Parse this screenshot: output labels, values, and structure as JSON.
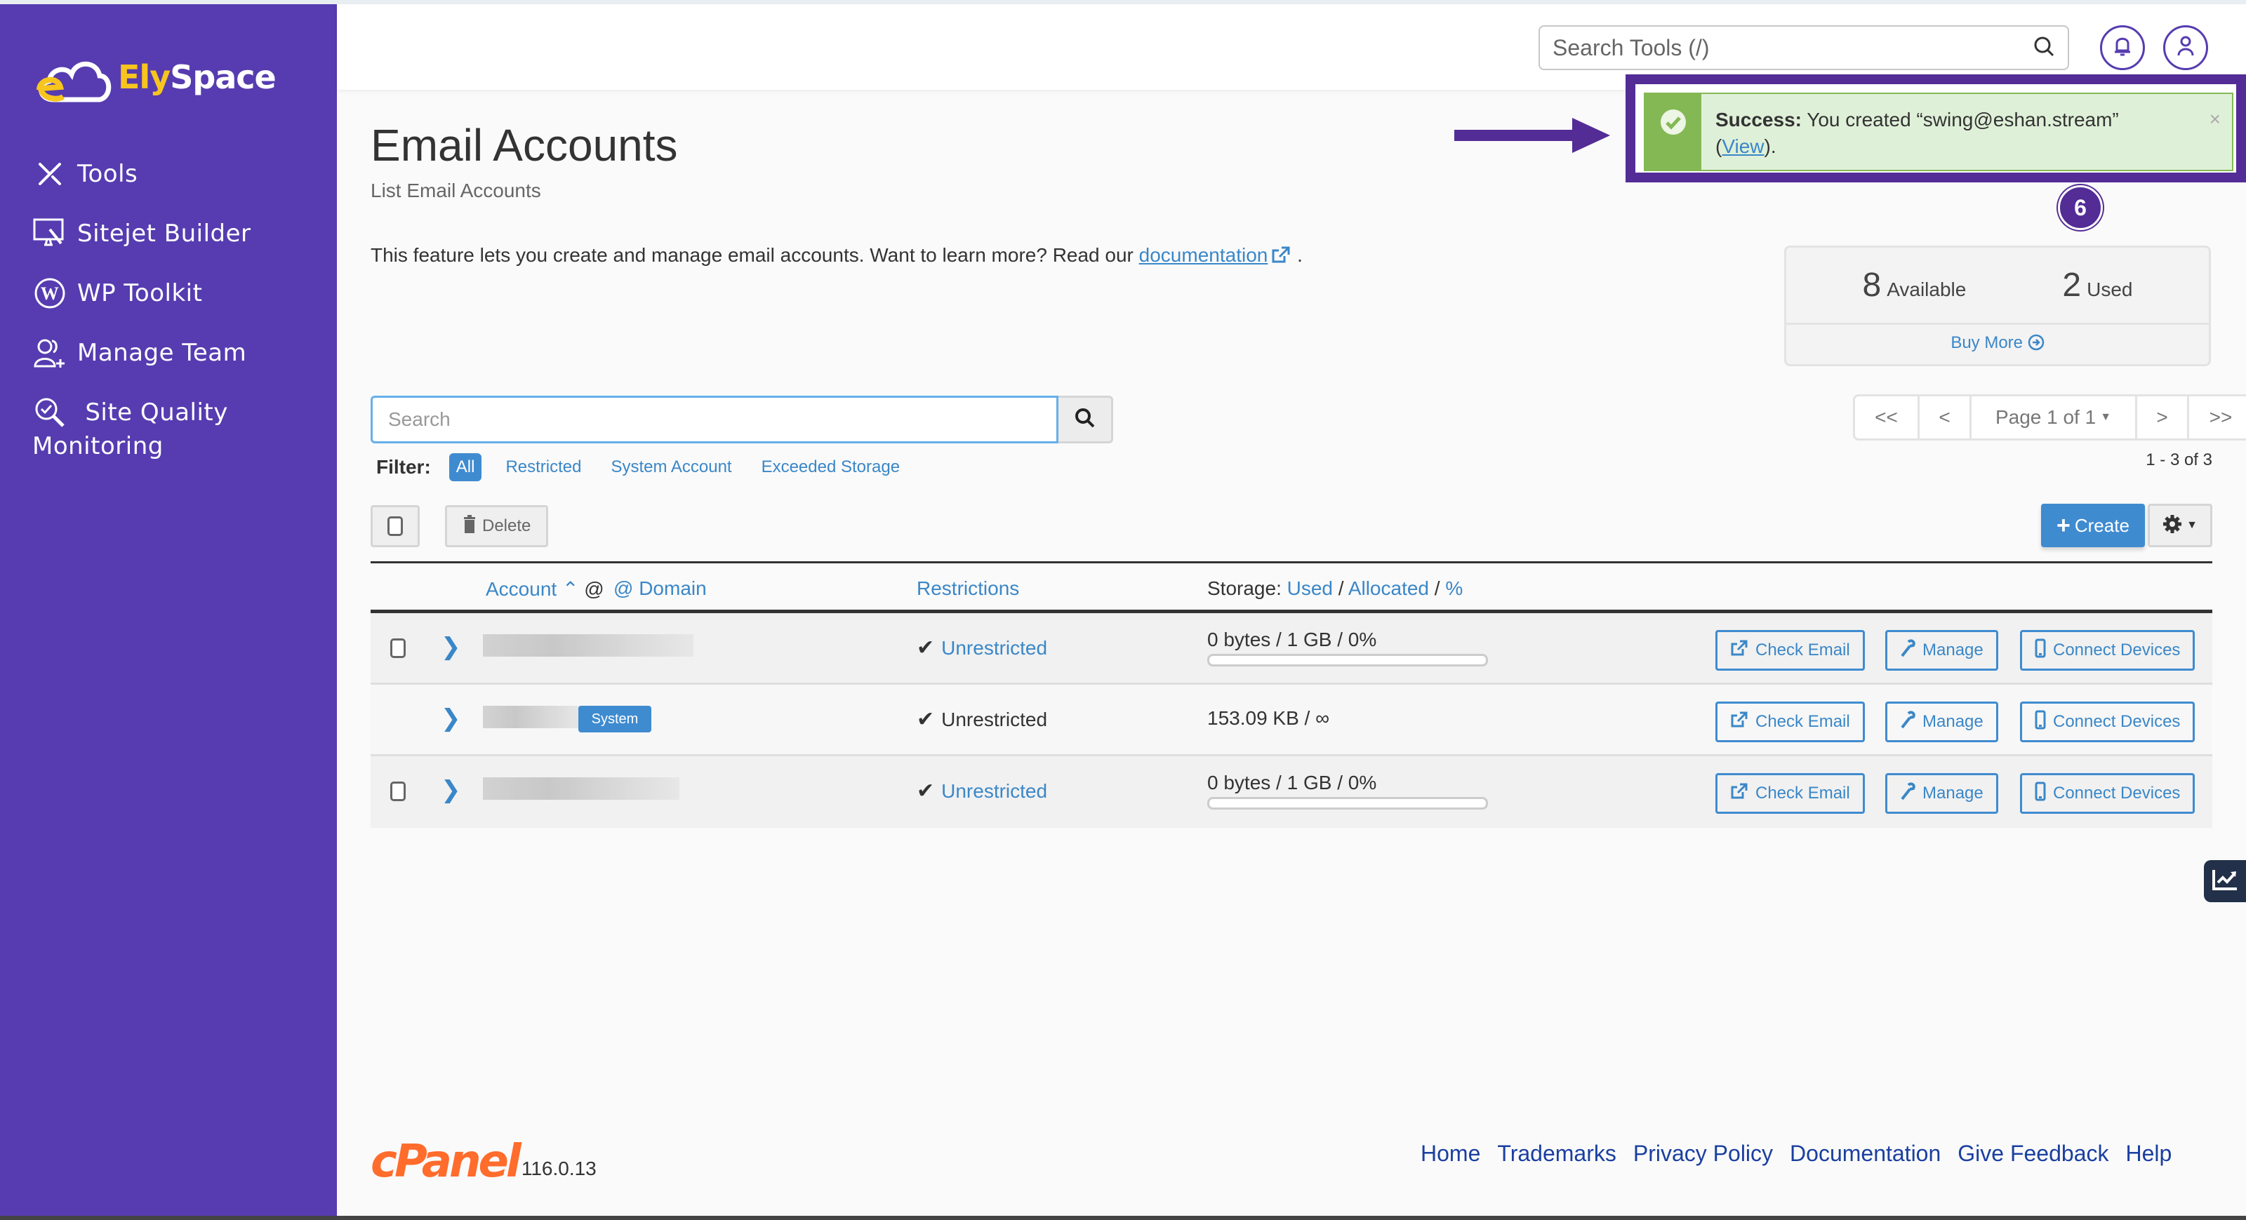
{
  "brand": {
    "name_part1": "Ely",
    "name_part2": "Space"
  },
  "sidebar": {
    "items": [
      {
        "label": "Tools",
        "icon": "tools-icon"
      },
      {
        "label": "Sitejet Builder",
        "icon": "monitor-pen-icon"
      },
      {
        "label": "WP Toolkit",
        "icon": "wordpress-icon"
      },
      {
        "label": "Manage Team",
        "icon": "user-add-icon"
      },
      {
        "label": "Site Quality Monitoring",
        "icon": "search-check-icon"
      }
    ]
  },
  "topbar": {
    "search_placeholder": "Search Tools (/)",
    "notifications_icon": "bell-icon",
    "user_icon": "user-icon"
  },
  "toast": {
    "title": "Success:",
    "message": " You created “swing@eshan.stream”",
    "link_open": "(",
    "link": "View",
    "link_close": ").",
    "close": "×",
    "annotation_number": "6"
  },
  "page": {
    "title": "Email Accounts",
    "subtitle": "List Email Accounts",
    "intro_text": "This feature lets you create and manage email accounts. Want to learn more? Read our ",
    "intro_link": "documentation",
    "intro_end": " ."
  },
  "stats": {
    "available_count": "8",
    "available_label": "Available",
    "used_count": "2",
    "used_label": "Used",
    "buy_more": "Buy More"
  },
  "pagination": {
    "first": "<<",
    "prev": "<",
    "page_label": "Page 1 of 1",
    "next": ">",
    "last": ">>",
    "range": "1 - 3 of 3"
  },
  "search": {
    "placeholder": "Search",
    "value": ""
  },
  "filter": {
    "label": "Filter:",
    "options": [
      "All",
      "Restricted",
      "System Account",
      "Exceeded Storage"
    ],
    "selected": "All"
  },
  "actions": {
    "delete": "Delete",
    "create": "Create"
  },
  "table": {
    "headers": {
      "account": "Account",
      "at_domain": "@ Domain",
      "restrictions": "Restrictions",
      "storage_prefix": "Storage:",
      "used": "Used",
      "allocated": "Allocated",
      "percent": "%"
    },
    "rows": [
      {
        "account": "[redacted]",
        "system": false,
        "restriction": "Unrestricted",
        "restriction_link": true,
        "storage": "0 bytes / 1 GB / 0%",
        "usage_percent": 0,
        "has_bar": true
      },
      {
        "account": "[redacted]",
        "system": true,
        "system_label": "System",
        "restriction": "Unrestricted",
        "restriction_link": false,
        "storage": "153.09 KB / ∞",
        "has_bar": false
      },
      {
        "account": "[redacted]",
        "system": false,
        "restriction": "Unrestricted",
        "restriction_link": true,
        "storage": "0 bytes / 1 GB / 0%",
        "usage_percent": 0,
        "has_bar": true
      }
    ],
    "row_actions": {
      "check_email": "Check Email",
      "manage": "Manage",
      "connect_devices": "Connect Devices"
    }
  },
  "footer": {
    "logo": "cPanel",
    "version": "116.0.13",
    "links": [
      "Home",
      "Trademarks",
      "Privacy Policy",
      "Documentation",
      "Give Feedback",
      "Help"
    ]
  },
  "colors": {
    "sidebar": "#563cb0",
    "accent_blue": "#3f8bd0",
    "success_green": "#84b854",
    "annotation_purple": "#532c96",
    "cpanel_orange": "#ff6c2c"
  }
}
